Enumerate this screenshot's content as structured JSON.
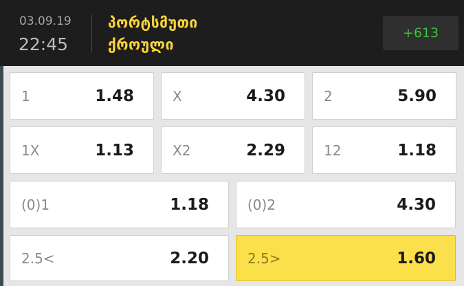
{
  "header": {
    "date": "03.09.19",
    "time": "22:45",
    "team1": "პორტსმუთი",
    "team2": "ქროული",
    "more_count": "+613"
  },
  "colors": {
    "header_bg": "#1d1d1d",
    "team_name": "#ffd53a",
    "more_count": "#3fbf3f",
    "selected_odd": "#fbe04b"
  },
  "odds": [
    {
      "label": "1",
      "value": "1.48",
      "selected": false
    },
    {
      "label": "X",
      "value": "4.30",
      "selected": false
    },
    {
      "label": "2",
      "value": "5.90",
      "selected": false
    },
    {
      "label": "1X",
      "value": "1.13",
      "selected": false
    },
    {
      "label": "X2",
      "value": "2.29",
      "selected": false
    },
    {
      "label": "12",
      "value": "1.18",
      "selected": false
    },
    {
      "label": "(0)1",
      "value": "1.18",
      "selected": false
    },
    {
      "label": "(0)2",
      "value": "4.30",
      "selected": false
    },
    {
      "label": "2.5<",
      "value": "2.20",
      "selected": false
    },
    {
      "label": "2.5>",
      "value": "1.60",
      "selected": true
    }
  ]
}
